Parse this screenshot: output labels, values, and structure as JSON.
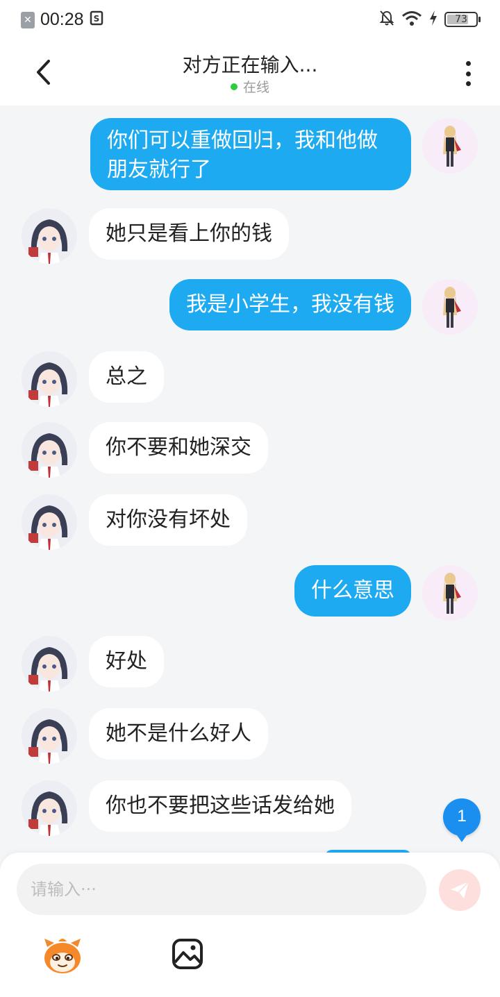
{
  "status_bar": {
    "time": "00:28",
    "battery": "73"
  },
  "header": {
    "title": "对方正在输入...",
    "status": "在线"
  },
  "messages": [
    {
      "side": "right",
      "text_line1": "你们可以重做回归，我和他做",
      "text_line2": "朋友就行了"
    },
    {
      "side": "left",
      "text": "她只是看上你的钱"
    },
    {
      "side": "right",
      "text": "我是小学生，我没有钱"
    },
    {
      "side": "left",
      "text": "总之"
    },
    {
      "side": "left",
      "text": "你不要和她深交"
    },
    {
      "side": "left",
      "text": "对你没有坏处"
    },
    {
      "side": "right",
      "text": "什么意思"
    },
    {
      "side": "left",
      "text": "好处"
    },
    {
      "side": "left",
      "text": "她不是什么好人"
    },
    {
      "side": "left",
      "text": "你也不要把这些话发给她"
    }
  ],
  "unread_badge": "1",
  "input": {
    "placeholder": "请输入···",
    "value": ""
  },
  "icons": {
    "back": "chevron-left-icon",
    "more": "more-vertical-icon",
    "send": "paper-plane-icon",
    "emoji": "emoji-mascot-icon",
    "image": "image-icon"
  },
  "colors": {
    "accent": "#1eaaf1",
    "online": "#2ecc40",
    "badge": "#1a8ff0",
    "send_disabled": "#fde0dd"
  }
}
